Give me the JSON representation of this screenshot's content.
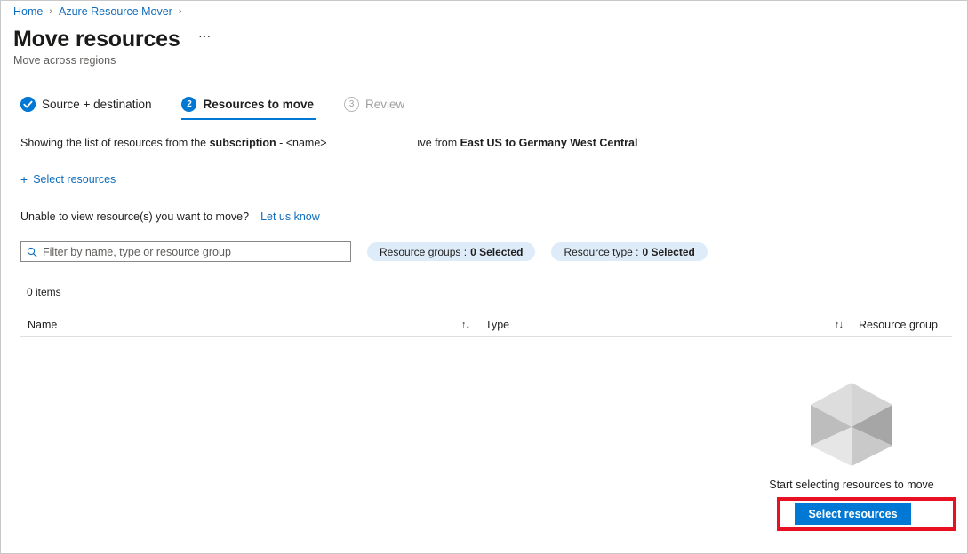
{
  "breadcrumb": {
    "items": [
      {
        "label": "Home"
      },
      {
        "label": "Azure Resource Mover"
      }
    ],
    "separator": "›"
  },
  "header": {
    "title": "Move resources",
    "subtitle": "Move across regions",
    "more_label": "…"
  },
  "wizard": {
    "steps": [
      {
        "number": "✓",
        "label": "Source + destination",
        "state": "done"
      },
      {
        "number": "2",
        "label": "Resources to move",
        "state": "active"
      },
      {
        "number": "3",
        "label": "Review",
        "state": "future"
      }
    ]
  },
  "info": {
    "line1_prefix": "Showing the list of resources from the ",
    "line1_bold": "subscription",
    "line1_suffix": " - <name>",
    "line2_prefix": "ıve from ",
    "line2_bold": "East US to Germany West Central"
  },
  "commands": {
    "select_resources_icon": "plus-icon",
    "select_resources_label": "Select resources"
  },
  "notice": {
    "text": "Unable to view resource(s) you want to move?",
    "link_label": "Let us know"
  },
  "filters": {
    "search_placeholder": "Filter by name, type or resource group",
    "search_value": "",
    "pills": [
      {
        "label": "Resource groups :",
        "value": "0 Selected"
      },
      {
        "label": "Resource type :",
        "value": "0 Selected"
      }
    ]
  },
  "table": {
    "items_count": "0 items",
    "sort_icon": "↑↓",
    "columns": [
      {
        "label": "Name",
        "sortable": true
      },
      {
        "label": "Type",
        "sortable": true
      },
      {
        "label": "Resource group",
        "sortable": false
      }
    ],
    "rows": []
  },
  "empty_state": {
    "illustration": "cube-icon",
    "message": "Start selecting resources to move",
    "button_label": "Select resources"
  },
  "colors": {
    "accent": "#0078d4",
    "link": "#0f6cbd",
    "highlight": "#e81123",
    "pill_bg": "#deecf9"
  }
}
